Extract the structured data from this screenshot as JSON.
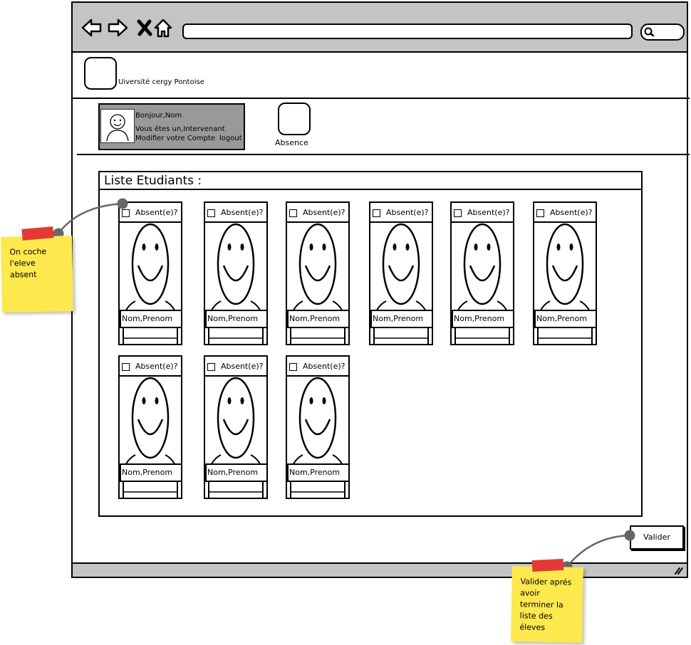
{
  "header": {
    "university": "Uiversité cergy Pontoise"
  },
  "user": {
    "greeting": "Bonjour,Nom",
    "role": "Vous étes un,Intervenant",
    "modify": "Modifier votre Compte",
    "logout": "logout"
  },
  "nav": {
    "absence": "Absence"
  },
  "list": {
    "title": "Liste Etudiants :",
    "students": [
      {
        "checkbox": "Absent(e)?",
        "name": "Nom,Prenom"
      },
      {
        "checkbox": "Absent(e)?",
        "name": "Nom,Prenom"
      },
      {
        "checkbox": "Absent(e)?",
        "name": "Nom,Prenom"
      },
      {
        "checkbox": "Absent(e)?",
        "name": "Nom,Prenom"
      },
      {
        "checkbox": "Absent(e)?",
        "name": "Nom,Prenom"
      },
      {
        "checkbox": "Absent(e)?",
        "name": "Nom,Prenom"
      },
      {
        "checkbox": "Absent(e)?",
        "name": "Nom,Prenom"
      },
      {
        "checkbox": "Absent(e)?",
        "name": "Nom,Prenom"
      },
      {
        "checkbox": "Absent(e)?",
        "name": "Nom,Prenom"
      }
    ]
  },
  "actions": {
    "validate": "Valider"
  },
  "notes": {
    "left": [
      "On coche",
      "l'eleve",
      "absent"
    ],
    "right": [
      "Valider aprés",
      "avoir",
      "terminer la",
      "liste des",
      "éleves"
    ]
  },
  "colors": {
    "chrome": "#c4c4c4",
    "user_card": "#999999",
    "sticky": "#fde84e",
    "tape": "#e53935"
  }
}
